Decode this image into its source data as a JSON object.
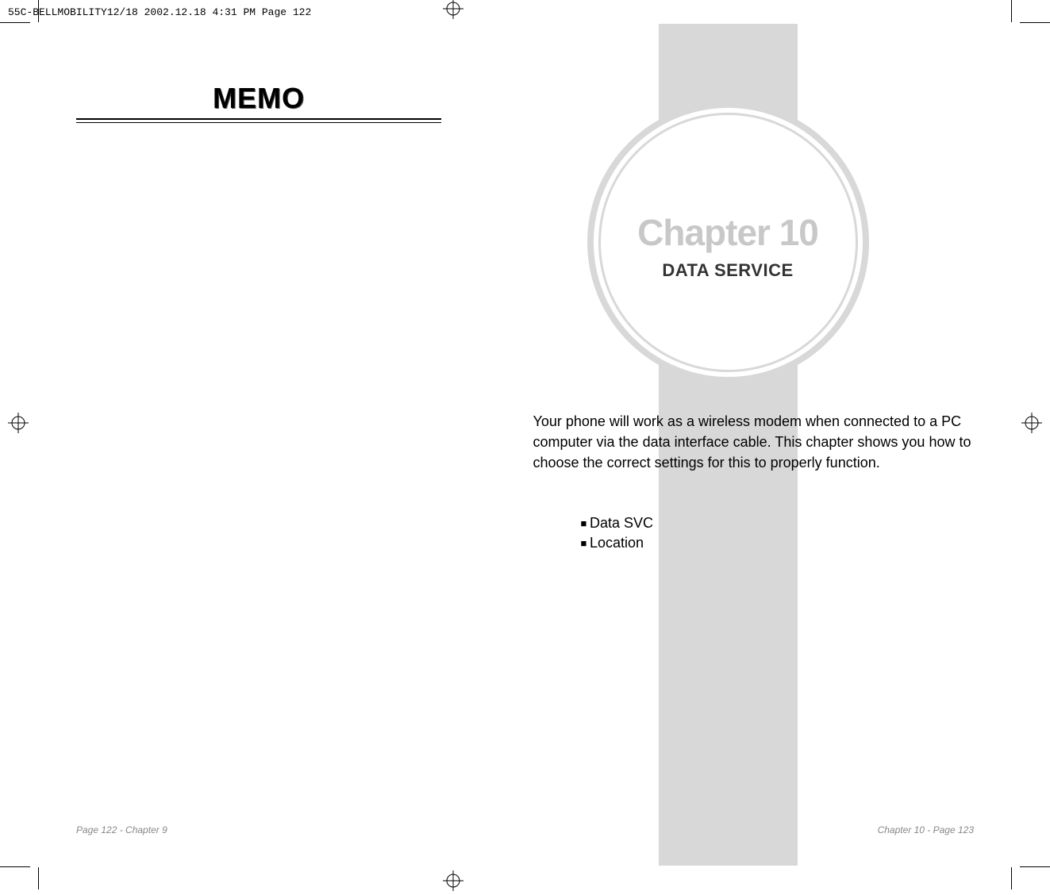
{
  "header": {
    "file_info": "55C-BELLMOBILITY12/18  2002.12.18  4:31 PM  Page 122"
  },
  "left_page": {
    "memo_title": "MEMO",
    "footer": "Page 122 - Chapter 9"
  },
  "right_page": {
    "chapter_title": "Chapter 10",
    "chapter_subtitle": "DATA SERVICE",
    "body_text": "Your phone will work as a wireless modem when connected to a PC computer via the data interface cable. This chapter shows you how to choose the correct settings for this to properly function.",
    "bullets": {
      "item1": "Data SVC",
      "item2": "Location"
    },
    "footer": "Chapter 10 - Page 123"
  }
}
